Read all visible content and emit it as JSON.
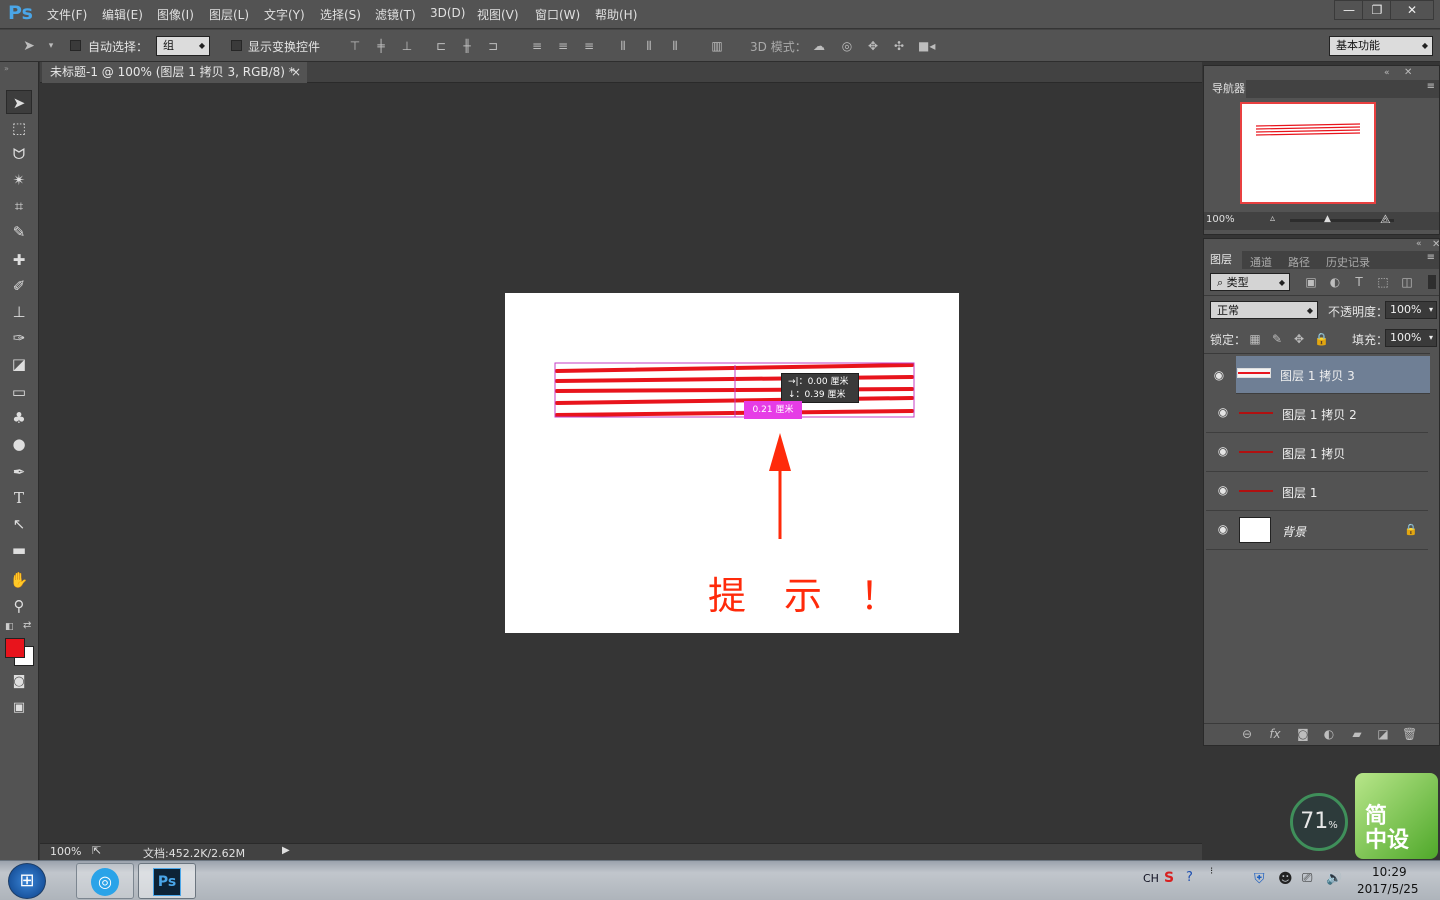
{
  "app": {
    "logo": "Ps"
  },
  "menu": [
    "文件(F)",
    "编辑(E)",
    "图像(I)",
    "图层(L)",
    "文字(Y)",
    "选择(S)",
    "滤镜(T)",
    "3D(D)",
    "视图(V)",
    "窗口(W)",
    "帮助(H)"
  ],
  "window_controls": {
    "minimize": "—",
    "restore": "❐",
    "close": "✕"
  },
  "options": {
    "auto_select_label": "自动选择：",
    "auto_select_value": "组",
    "show_transform_label": "显示变换控件",
    "mode_3d_label": "3D 模式：",
    "workspace": "基本功能"
  },
  "document_tab": {
    "title": "未标题-1 @ 100% (图层 1 拷贝 3, RGB/8) *",
    "close": "×"
  },
  "canvas": {
    "tooltip_line1": "→|：0.00 厘米",
    "tooltip_line2": "↓：0.39 厘米",
    "spacing_label": "0.21 厘米",
    "hint_text": "提　示　！",
    "line_color": "#e8141c"
  },
  "status": {
    "zoom": "100%",
    "doc_size": "文档:452.2K/2.62M"
  },
  "navigator": {
    "tab": "导航器",
    "zoom": "100%"
  },
  "layers_panel": {
    "tabs": [
      "图层",
      "通道",
      "路径",
      "历史记录"
    ],
    "filter_kind": "类型",
    "blend_mode": "正常",
    "opacity_label": "不透明度：",
    "opacity_value": "100%",
    "lock_label": "锁定：",
    "fill_label": "填充：",
    "fill_value": "100%",
    "layers": [
      {
        "name": "图层 1 拷贝 3",
        "selected": true
      },
      {
        "name": "图层 1 拷贝 2",
        "selected": false
      },
      {
        "name": "图层 1 拷贝",
        "selected": false
      },
      {
        "name": "图层 1",
        "selected": false
      },
      {
        "name": "背景",
        "selected": false,
        "locked": true
      }
    ]
  },
  "tools": [
    "move-icon",
    "marquee-icon",
    "lasso-icon",
    "magic-wand-icon",
    "crop-icon",
    "eyedropper-icon",
    "healing-brush-icon",
    "brush-icon",
    "stamp-icon",
    "history-brush-icon",
    "eraser-icon",
    "gradient-icon",
    "blur-icon",
    "dodge-icon",
    "pen-icon",
    "type-icon",
    "path-selection-icon",
    "shape-icon",
    "hand-icon",
    "zoom-icon"
  ],
  "colors": {
    "foreground": "#e8141c",
    "background": "#ffffff"
  },
  "widget": {
    "percent": "71",
    "percent_sign": "%",
    "brand": "简\n中设"
  },
  "taskbar": {
    "lang": "CH",
    "time": "10:29",
    "date": "2017/5/25"
  }
}
